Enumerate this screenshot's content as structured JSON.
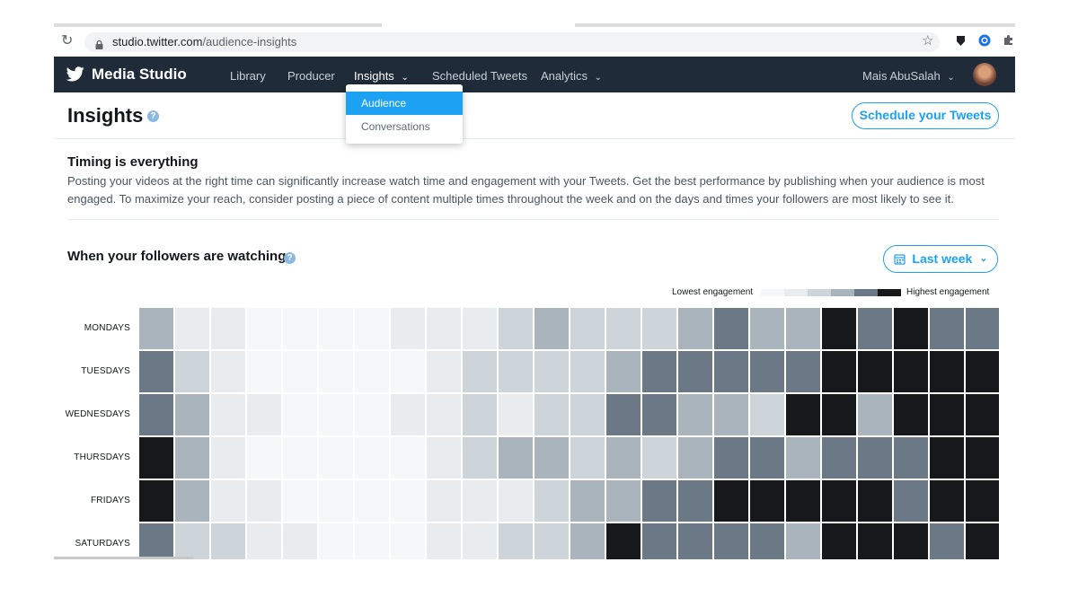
{
  "browser": {
    "url_host": "studio.twitter.com",
    "url_path": "/audience-insights",
    "reload_icon": "reload-icon",
    "lock_icon": "lock-icon",
    "star_icon": "star-icon",
    "extension_icons": [
      "shield-extension-icon",
      "circle-extension-icon",
      "puzzle-extension-icon"
    ]
  },
  "nav": {
    "brand": "Media Studio",
    "items": [
      "Library",
      "Producer",
      "Insights",
      "Scheduled Tweets",
      "Analytics"
    ],
    "user_name": "Mais AbuSalah",
    "dropdown_items": [
      "Audience",
      "Conversations"
    ]
  },
  "page": {
    "title": "Insights",
    "schedule_button": "Schedule your Tweets",
    "timing_title": "Timing is everything",
    "timing_desc": "Posting your videos at the right time can significantly increase watch time and engagement with your Tweets. Get the best performance by publishing when your audience is most engaged. To maximize your reach, consider posting a piece of content multiple times throughout the week and on the days and times your followers are most likely to see it.",
    "heatmap_title": "When your followers are watching",
    "range_button": "Last week"
  },
  "colors": {
    "accent": "#1da1f2",
    "nav_bg": "#1f2b38",
    "scale": [
      "#f5f7f9",
      "#e8ecef",
      "#cdd4da",
      "#a9b4bd",
      "#6b7886",
      "#16181c"
    ]
  },
  "chart_data": {
    "type": "heatmap",
    "legend_low": "Lowest engagement",
    "legend_high": "Highest engagement",
    "rows": [
      "MONDAYS",
      "TUESDAYS",
      "WEDNESDAYS",
      "THURSDAYS",
      "FRIDAYS",
      "SATURDAYS"
    ],
    "columns": 24,
    "levels": [
      [
        3,
        1,
        1,
        0,
        0,
        0,
        0,
        1,
        1,
        1,
        2,
        3,
        2,
        2,
        2,
        3,
        4,
        3,
        3,
        5,
        4,
        5,
        4,
        4
      ],
      [
        4,
        2,
        1,
        0,
        0,
        0,
        0,
        0,
        1,
        2,
        2,
        2,
        2,
        3,
        4,
        4,
        4,
        4,
        4,
        5,
        5,
        5,
        5,
        5
      ],
      [
        4,
        3,
        1,
        1,
        0,
        0,
        0,
        1,
        1,
        2,
        1,
        2,
        2,
        4,
        4,
        3,
        3,
        2,
        5,
        5,
        3,
        5,
        5,
        5
      ],
      [
        5,
        3,
        1,
        0,
        0,
        0,
        0,
        0,
        1,
        2,
        3,
        3,
        2,
        3,
        2,
        3,
        4,
        4,
        3,
        4,
        4,
        4,
        5,
        5
      ],
      [
        5,
        3,
        1,
        1,
        0,
        0,
        0,
        0,
        1,
        1,
        1,
        2,
        3,
        3,
        4,
        4,
        5,
        5,
        5,
        5,
        5,
        4,
        5,
        5
      ],
      [
        4,
        2,
        2,
        1,
        1,
        0,
        0,
        0,
        1,
        1,
        2,
        2,
        3,
        5,
        4,
        4,
        4,
        4,
        3,
        5,
        5,
        5,
        4,
        5
      ]
    ]
  }
}
